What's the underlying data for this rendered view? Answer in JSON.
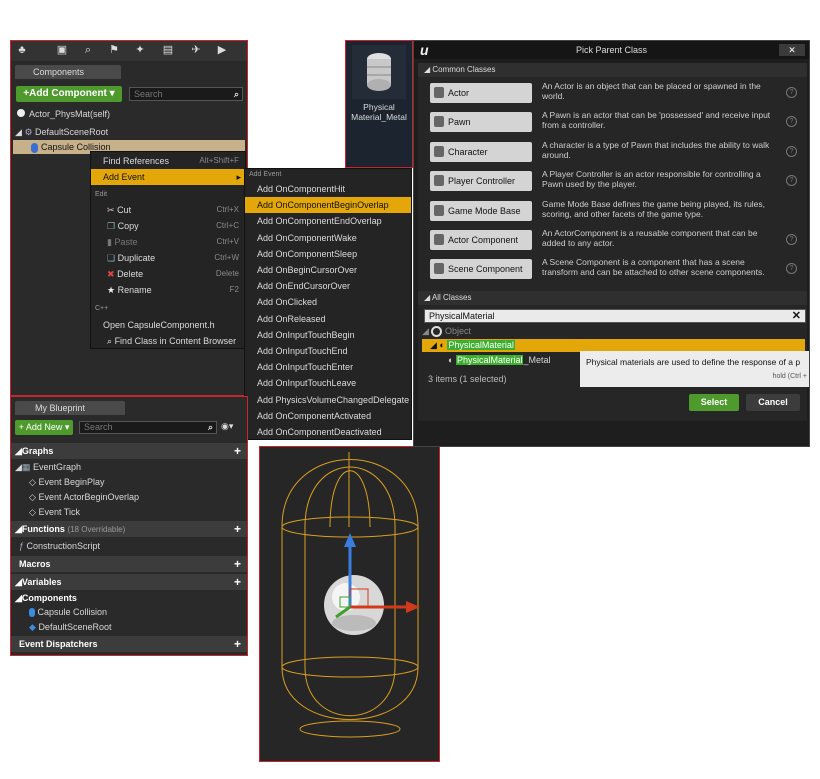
{
  "components_panel": {
    "tab": "Components",
    "add_button": "+Add Component",
    "search_placeholder": "Search",
    "self_item": "Actor_PhysMat(self)",
    "root_item": "DefaultSceneRoot",
    "capsule_item": "Capsule Collision"
  },
  "context_menu": {
    "find_references": "Find References",
    "find_references_key": "Alt+Shift+F",
    "add_event": "Add Event",
    "edit_header": "Edit",
    "cut": "Cut",
    "cut_key": "Ctrl+X",
    "copy": "Copy",
    "copy_key": "Ctrl+C",
    "paste": "Paste",
    "paste_key": "Ctrl+V",
    "duplicate": "Duplicate",
    "duplicate_key": "Ctrl+W",
    "delete": "Delete",
    "delete_key": "Delete",
    "rename": "Rename",
    "rename_key": "F2",
    "cpp_header": "C++",
    "open_file": "Open CapsuleComponent.h",
    "find_class": "Find Class in Content Browser"
  },
  "event_menu": {
    "header": "Add Event",
    "items": [
      "Add OnComponentHit",
      "Add OnComponentBeginOverlap",
      "Add OnComponentEndOverlap",
      "Add OnComponentWake",
      "Add OnComponentSleep",
      "Add OnBeginCursorOver",
      "Add OnEndCursorOver",
      "Add OnClicked",
      "Add OnReleased",
      "Add OnInputTouchBegin",
      "Add OnInputTouchEnd",
      "Add OnInputTouchEnter",
      "Add OnInputTouchLeave",
      "Add PhysicsVolumeChangedDelegate",
      "Add OnComponentActivated",
      "Add OnComponentDeactivated"
    ]
  },
  "my_blueprint": {
    "tab": "My Blueprint",
    "add_new": "+ Add New",
    "search_placeholder": "Search",
    "graphs": "Graphs",
    "event_graph": "EventGraph",
    "event_begin_play": "Event BeginPlay",
    "event_actor_overlap": "Event ActorBeginOverlap",
    "event_tick": "Event Tick",
    "functions": "Functions",
    "functions_note": "(18 Overridable)",
    "construction_script": "ConstructionScript",
    "macros": "Macros",
    "variables": "Variables",
    "components": "Components",
    "capsule": "Capsule Collision",
    "default_root": "DefaultSceneRoot",
    "event_dispatchers": "Event Dispatchers"
  },
  "asset": {
    "label_line1": "Physical",
    "label_line2": "Material_Metal"
  },
  "pick_parent": {
    "title": "Pick Parent Class",
    "close": "✕",
    "common_header": "Common Classes",
    "classes": [
      {
        "name": "Actor",
        "desc": "An Actor is an object that can be placed or spawned in the world."
      },
      {
        "name": "Pawn",
        "desc": "A Pawn is an actor that can be 'possessed' and receive input from a controller."
      },
      {
        "name": "Character",
        "desc": "A character is a type of Pawn that includes the ability to walk around."
      },
      {
        "name": "Player Controller",
        "desc": "A Player Controller is an actor responsible for controlling a Pawn used by the player."
      },
      {
        "name": "Game Mode Base",
        "desc": "Game Mode Base defines the game being played, its rules, scoring, and other facets of the game type."
      },
      {
        "name": "Actor Component",
        "desc": "An ActorComponent is a reusable component that can be added to any actor."
      },
      {
        "name": "Scene Component",
        "desc": "A Scene Component is a component that has a scene transform and can be attached to other scene components."
      }
    ],
    "all_header": "All Classes",
    "search_value": "PhysicalMaterial",
    "tree_object": "Object",
    "tree_physmat": "PhysicalMaterial",
    "tree_metal_a": "PhysicalMaterial",
    "tree_metal_b": "_Metal",
    "items_count": "3 items (1 selected)",
    "tooltip": "Physical materials are used to define the response of a p",
    "tooltip_hint": "hold (Ctrl +",
    "select": "Select",
    "cancel": "Cancel"
  },
  "colors": {
    "accent_orange": "#e3a70a",
    "green_button": "#4e9a2c",
    "frame_red": "#c8262b",
    "capsule_wire": "#d9a020"
  }
}
